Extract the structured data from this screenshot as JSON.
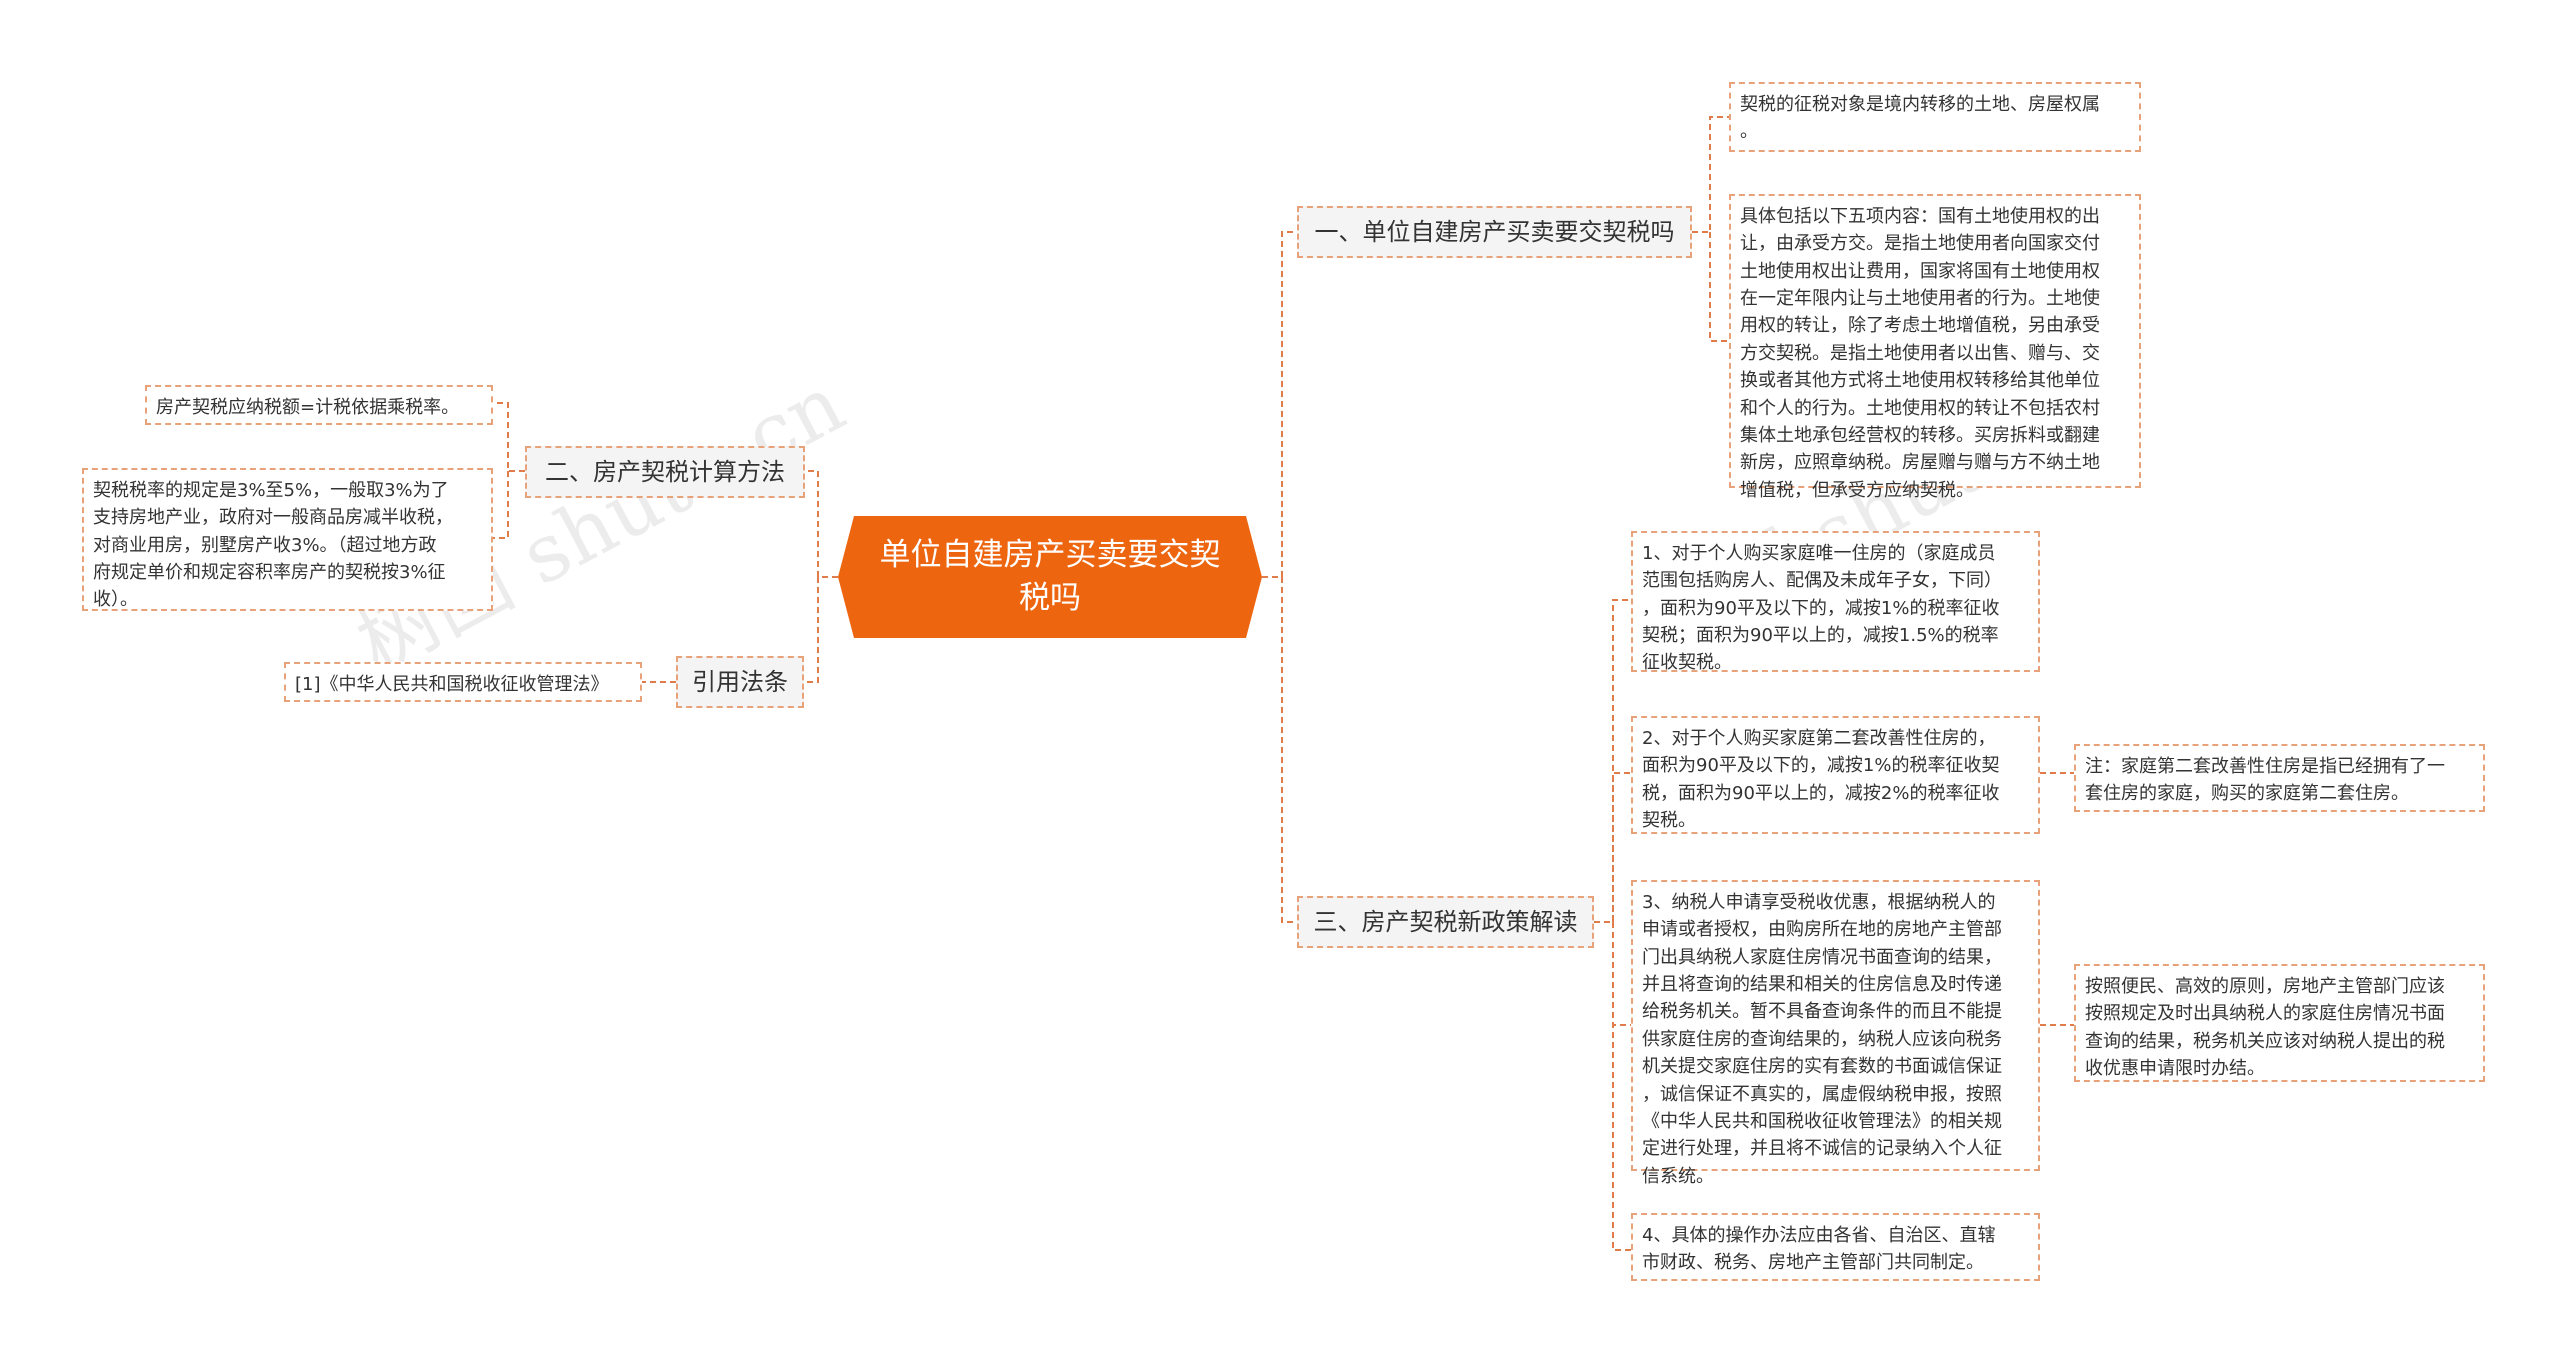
{
  "root": {
    "title": "单位自建房产买卖要交契税吗"
  },
  "branches": {
    "b1": {
      "label": "一、单位自建房产买卖要交契税吗"
    },
    "b2": {
      "label": "二、房产契税计算方法"
    },
    "b3": {
      "label": "引用法条"
    },
    "b4": {
      "label": "三、房产契税新政策解读"
    }
  },
  "leaves": {
    "b1_1": "契税的征税对象是境内转移的土地、房屋权属\n。",
    "b1_2": "具体包括以下五项内容：国有土地使用权的出\n让，由承受方交。是指土地使用者向国家交付\n土地使用权出让费用，国家将国有土地使用权\n在一定年限内让与土地使用者的行为。土地使\n用权的转让，除了考虑土地增值税，另由承受\n方交契税。是指土地使用者以出售、赠与、交\n换或者其他方式将土地使用权转移给其他单位\n和个人的行为。土地使用权的转让不包括农村\n集体土地承包经营权的转移。买房拆料或翻建\n新房，应照章纳税。房屋赠与赠与方不纳土地\n增值税，但承受方应纳契税。",
    "b2_1": "房产契税应纳税额=计税依据乘税率。",
    "b2_2": "契税税率的规定是3%至5%，一般取3%为了\n支持房地产业，政府对一般商品房减半收税，\n对商业用房，别墅房产收3%。（超过地方政\n府规定单价和规定容积率房产的契税按3%征\n收）。",
    "b3_1": "[1]《中华人民共和国税收征收管理法》",
    "b4_1": "1、对于个人购买家庭唯一住房的（家庭成员\n范围包括购房人、配偶及未成年子女，下同）\n，面积为90平及以下的，减按1%的税率征收\n契税；面积为90平以上的，减按1.5%的税率\n征收契税。",
    "b4_2": "2、对于个人购买家庭第二套改善性住房的，\n面积为90平及以下的，减按1%的税率征收契\n税，面积为90平以上的，减按2%的税率征收\n契税。",
    "b4_2_note": "注：家庭第二套改善性住房是指已经拥有了一\n套住房的家庭，购买的家庭第二套住房。",
    "b4_3": "3、纳税人申请享受税收优惠，根据纳税人的\n申请或者授权，由购房所在地的房地产主管部\n门出具纳税人家庭住房情况书面查询的结果，\n并且将查询的结果和相关的住房信息及时传递\n给税务机关。暂不具备查询条件的而且不能提\n供家庭住房的查询结果的，纳税人应该向税务\n机关提交家庭住房的实有套数的书面诚信保证\n，诚信保证不真实的，属虚假纳税申报，按照\n《中华人民共和国税收征收管理法》的相关规\n定进行处理，并且将不诚信的记录纳入个人征\n信系统。",
    "b4_3_note": "按照便民、高效的原则，房地产主管部门应该\n按照规定及时出具纳税人的家庭住房情况书面\n查询的结果，税务机关应该对纳税人提出的税\n收优惠申请限时办结。",
    "b4_4": "4、具体的操作办法应由各省、自治区、直辖\n市财政、税务、房地产主管部门共同制定。"
  },
  "watermark": "树图 shutu.cn",
  "colors": {
    "root_fill": "#ee6510",
    "line": "#e07c4a",
    "border": "#e8a27a",
    "branch_fill": "#f4f4f4"
  }
}
